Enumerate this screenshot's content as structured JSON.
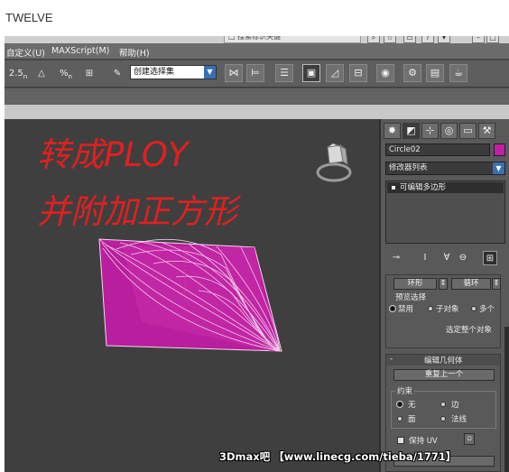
{
  "post": {
    "title": "TWELVE"
  },
  "menu": {
    "title_field": "□ 搜索标识关键",
    "items": [
      "自定义(U)",
      "MAXScript(M)",
      "帮助(H)"
    ]
  },
  "toolbar": {
    "snap_angle": "2.5",
    "percent_snap": "%",
    "selection_set": "创建选择集"
  },
  "annotation": {
    "line1": "转成PLOY",
    "line2": "并附加正方形",
    "color": "#e02020"
  },
  "object": {
    "color": "#c31ea6",
    "wire_color": "#f3d2ee"
  },
  "panel": {
    "object_name": "Circle02",
    "modifier_list": "修改器列表",
    "stack_item": "可编辑多边形",
    "ring_label": "环形",
    "loop_label": "循环",
    "preview_selection": "预览选择",
    "preview_options": [
      "禁用",
      "子对象",
      "多个"
    ],
    "selected_whole": "选定整个对象",
    "edit_geometry": "编辑几何体",
    "repeat_last": "重复上一个",
    "constraints": "约束",
    "constraint_options": [
      "无",
      "边",
      "面",
      "法线"
    ],
    "preserve_uv": "保持 UV",
    "collapse_minus": "-"
  },
  "watermark": "3Dmax吧 【www.linecg.com/tieba/1771】"
}
